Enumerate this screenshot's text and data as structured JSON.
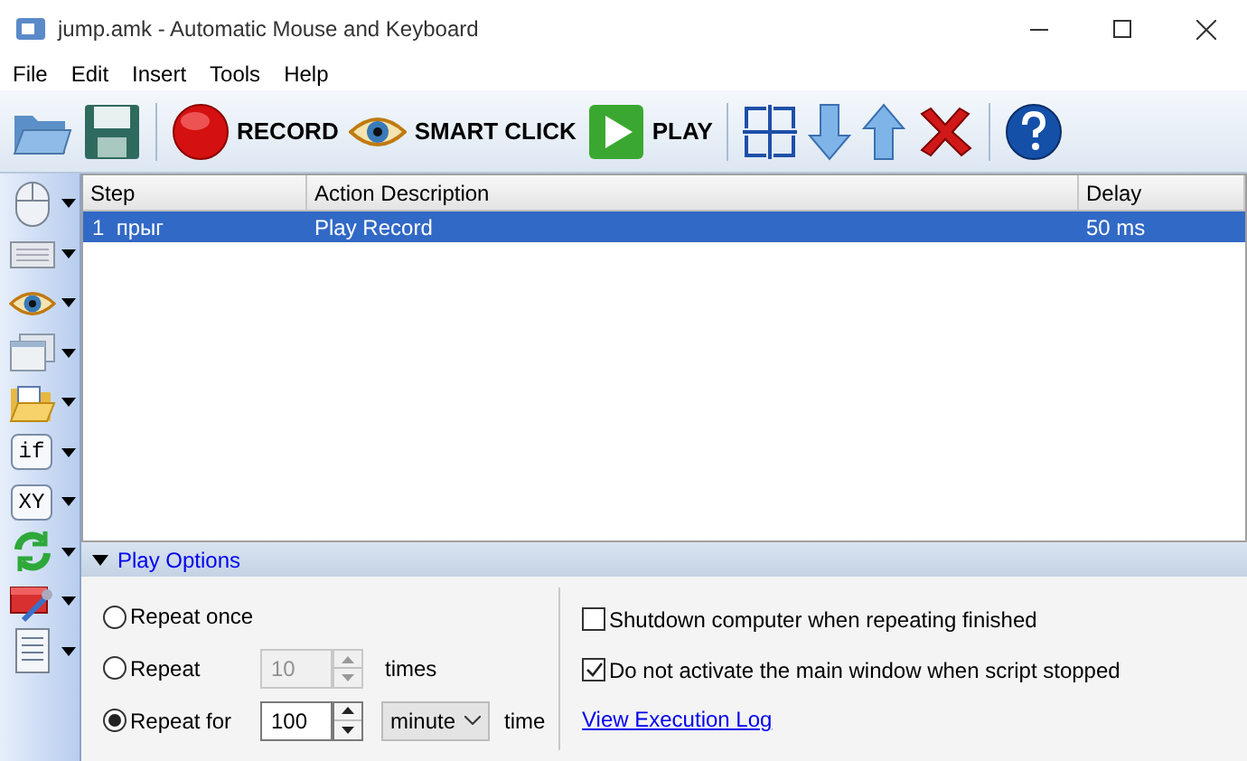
{
  "window": {
    "title": "jump.amk - Automatic Mouse and Keyboard"
  },
  "menu": [
    "File",
    "Edit",
    "Insert",
    "Tools",
    "Help"
  ],
  "toolbar": [
    {
      "kind": "open"
    },
    {
      "kind": "save"
    },
    {
      "kind": "sep"
    },
    {
      "kind": "record",
      "label": "RECORD"
    },
    {
      "kind": "smart",
      "label": "SMART CLICK"
    },
    {
      "kind": "play",
      "label": "PLAY"
    },
    {
      "kind": "sep"
    },
    {
      "kind": "frame"
    },
    {
      "kind": "down"
    },
    {
      "kind": "up"
    },
    {
      "kind": "delete"
    },
    {
      "kind": "sep"
    },
    {
      "kind": "help"
    }
  ],
  "sidebar": [
    {
      "kind": "mouse"
    },
    {
      "kind": "keyboard"
    },
    {
      "kind": "eye"
    },
    {
      "kind": "window"
    },
    {
      "kind": "folder"
    },
    {
      "kind": "text",
      "label": "if"
    },
    {
      "kind": "text",
      "label": "XY"
    },
    {
      "kind": "refresh"
    },
    {
      "kind": "tools"
    },
    {
      "kind": "document"
    }
  ],
  "table": {
    "columns": [
      "Step",
      "Action Description",
      "Delay"
    ],
    "rows": [
      {
        "step": "1  прыг",
        "action": "Play Record",
        "delay": "50 ms",
        "selected": true
      }
    ]
  },
  "play_options": {
    "title": "Play Options",
    "expanded": true,
    "repeat": [
      {
        "kind": "plain",
        "label": "Repeat once",
        "selected": false
      },
      {
        "kind": "count",
        "label": "Repeat",
        "value": "10",
        "unit": "times",
        "selected": false
      },
      {
        "kind": "time",
        "label": "Repeat for",
        "value": "100",
        "unit_select": "minute",
        "unit": "time",
        "selected": true
      }
    ],
    "checks": [
      {
        "label": "Shutdown computer when repeating finished",
        "checked": false
      },
      {
        "label": "Do not activate the main window when script stopped",
        "checked": true
      }
    ],
    "link": "View Execution Log"
  }
}
